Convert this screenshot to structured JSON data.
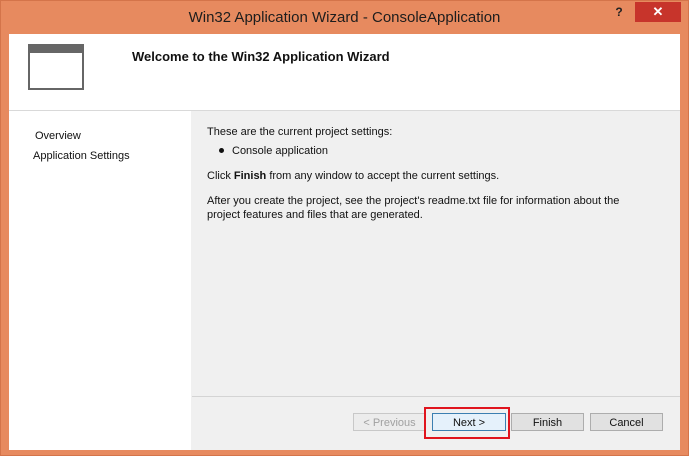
{
  "window": {
    "title": "Win32 Application Wizard - ConsoleApplication",
    "help_label": "?",
    "close_label": "✕"
  },
  "header": {
    "title": "Welcome to the Win32 Application Wizard",
    "icon": "window-icon"
  },
  "nav": {
    "items": [
      {
        "label": "Overview"
      },
      {
        "label": "Application Settings"
      }
    ]
  },
  "content": {
    "intro": "These are the current project settings:",
    "bullet": "Console application",
    "finish_prefix": "Click ",
    "finish_bold": "Finish",
    "finish_suffix": " from any window to accept the current settings.",
    "readme": "After you create the project, see the project's readme.txt file for information about the project features and files that are generated."
  },
  "buttons": {
    "previous": "< Previous",
    "next": "Next >",
    "finish": "Finish",
    "cancel": "Cancel"
  },
  "colors": {
    "titlebar": "#e78a5f",
    "close": "#c7342b",
    "highlight": "#e0141d"
  }
}
